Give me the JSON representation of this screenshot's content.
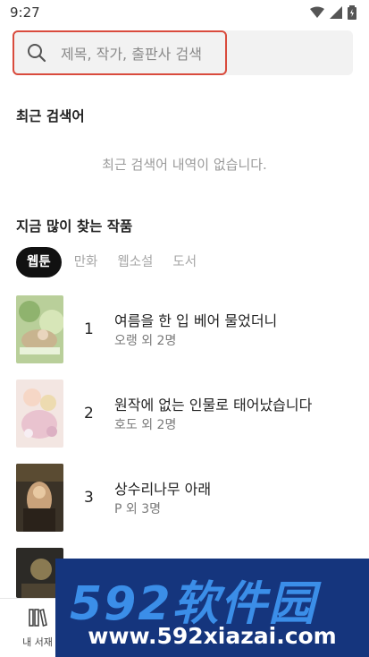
{
  "status_bar": {
    "time": "9:27"
  },
  "search": {
    "placeholder": "제목, 작가, 출판사 검색"
  },
  "recent": {
    "title": "최근 검색어",
    "empty_message": "최근 검색어 내역이 없습니다."
  },
  "popular": {
    "title": "지금 많이 찾는 작품",
    "tabs": [
      {
        "label": "웹툰",
        "active": true
      },
      {
        "label": "만화",
        "active": false
      },
      {
        "label": "웹소설",
        "active": false
      },
      {
        "label": "도서",
        "active": false
      }
    ],
    "items": [
      {
        "rank": "1",
        "title": "여름을 한 입 베어 물었더니",
        "author": "오랭 외 2명"
      },
      {
        "rank": "2",
        "title": "원작에 없는 인물로 태어났습니다",
        "author": "호도 외 2명"
      },
      {
        "rank": "3",
        "title": "상수리나무 아래",
        "author": "P 외 3명"
      }
    ]
  },
  "bottom_nav": {
    "library_label": "내 서재"
  },
  "watermark": {
    "brand": "592软件园",
    "url": "www.592xiazai.com"
  }
}
